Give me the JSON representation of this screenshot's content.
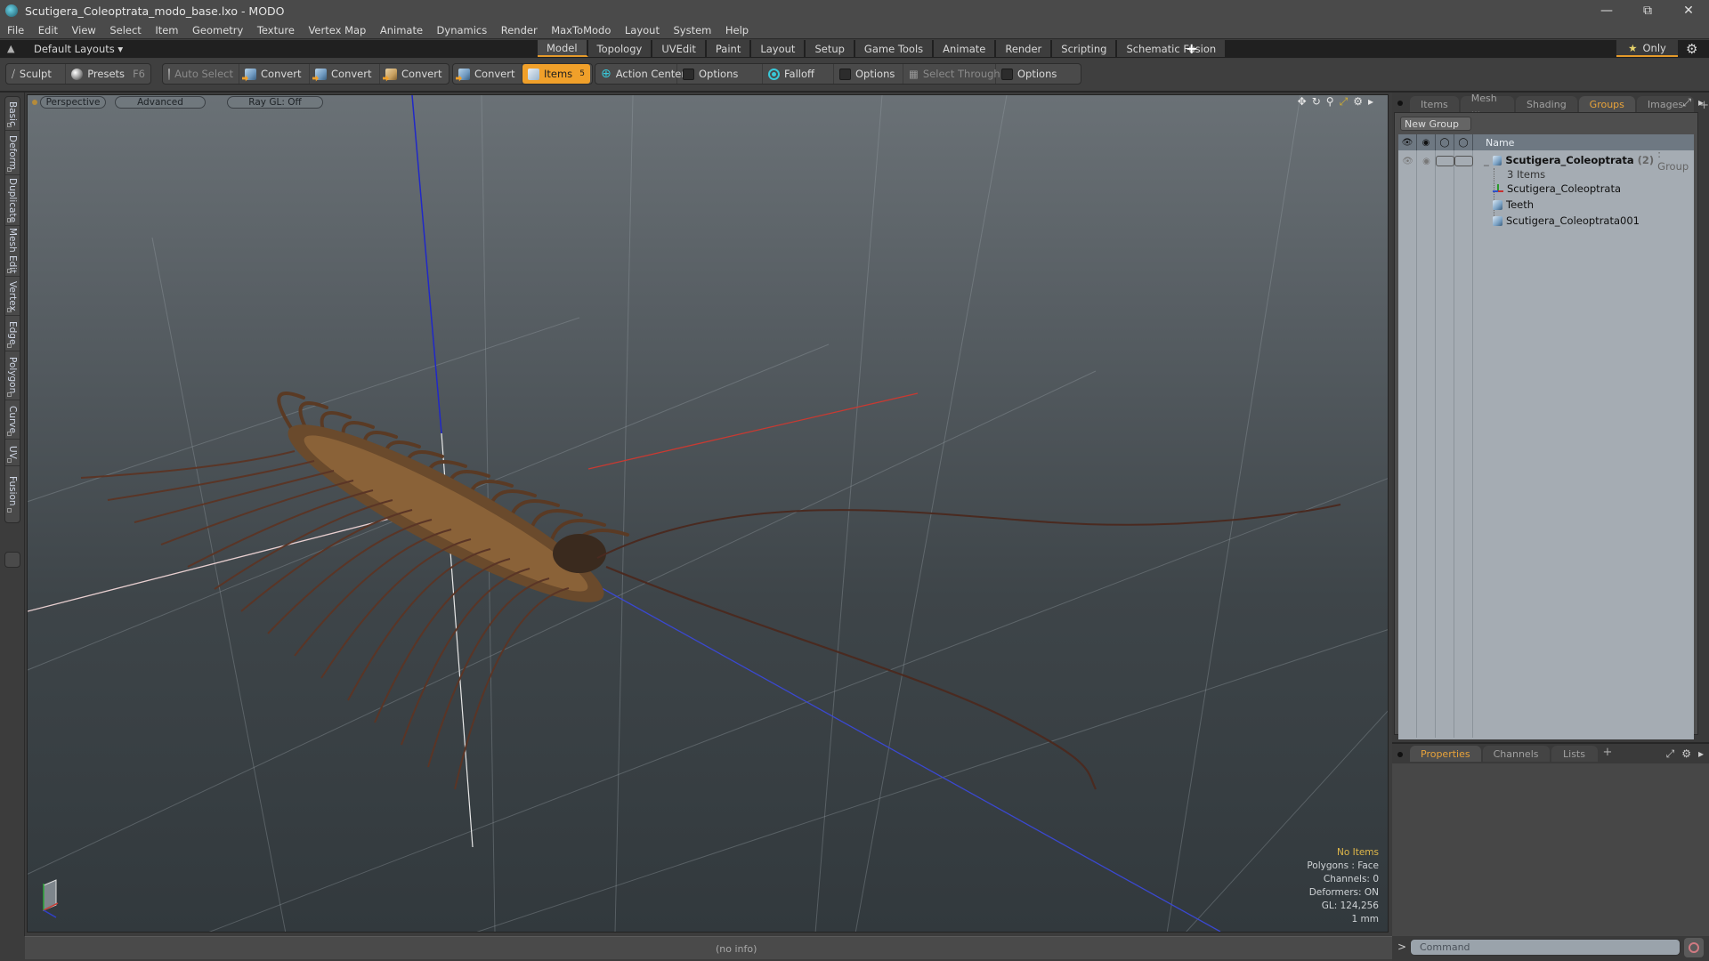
{
  "window": {
    "title": "Scutigera_Coleoptrata_modo_base.lxo - MODO",
    "controls": [
      "minimize",
      "restore",
      "close"
    ]
  },
  "menubar": {
    "items": [
      "File",
      "Edit",
      "View",
      "Select",
      "Item",
      "Geometry",
      "Texture",
      "Vertex Map",
      "Animate",
      "Dynamics",
      "Render",
      "MaxToModo",
      "Layout",
      "System",
      "Help"
    ]
  },
  "layoutbar": {
    "layouts_label": "Default Layouts",
    "tabs": [
      {
        "label": "Model",
        "active": true
      },
      {
        "label": "Topology",
        "active": false
      },
      {
        "label": "UVEdit",
        "active": false
      },
      {
        "label": "Paint",
        "active": false
      },
      {
        "label": "Layout",
        "active": false
      },
      {
        "label": "Setup",
        "active": false
      },
      {
        "label": "Game Tools",
        "active": false
      },
      {
        "label": "Animate",
        "active": false
      },
      {
        "label": "Render",
        "active": false
      },
      {
        "label": "Scripting",
        "active": false
      },
      {
        "label": "Schematic Fusion",
        "active": false
      }
    ],
    "add_tab": "+",
    "only_label": "Only"
  },
  "toolbar": {
    "sculpt": "Sculpt",
    "presets": "Presets",
    "presets_key": "F6",
    "auto_select": "Auto Select",
    "convert_1": "Convert",
    "convert_2": "Convert",
    "convert_3": "Convert",
    "convert_4": "Convert",
    "items": "Items",
    "items_count": "5",
    "action_center": "Action Center",
    "options_1": "Options",
    "falloff": "Falloff",
    "options_2": "Options",
    "select_through": "Select Through",
    "options_3": "Options"
  },
  "left_tabs": [
    "Basic",
    "Deform",
    "Duplicate",
    "Mesh Edit",
    "Vertex",
    "Edge",
    "Polygon",
    "Curve",
    "UV",
    "Fusion"
  ],
  "viewport": {
    "view_mode": "Perspective",
    "shading": "Advanced",
    "raygl": "Ray GL: Off",
    "info": {
      "selection": "No Items",
      "polygons": "Polygons : Face",
      "channels": "Channels: 0",
      "deformers": "Deformers: ON",
      "gl": "GL: 124,256",
      "unit": "1 mm"
    },
    "axis_colors": {
      "x": "#c83a32",
      "y": "#2fa83a",
      "z": "#3040c8"
    }
  },
  "right_panel": {
    "tabs": [
      {
        "label": "Items",
        "active": false
      },
      {
        "label": "Mesh ...",
        "active": false
      },
      {
        "label": "Shading",
        "active": false
      },
      {
        "label": "Groups",
        "active": true
      },
      {
        "label": "Images",
        "active": false
      }
    ],
    "new_group": "New Group",
    "column_name": "Name",
    "group": {
      "name": "Scutigera_Coleoptrata",
      "count": "(2)",
      "type": ": Group",
      "items_label": "3 Items",
      "children": [
        {
          "name": "Scutigera_Coleoptrata",
          "icon": "locator-icon"
        },
        {
          "name": "Teeth",
          "icon": "mesh-icon"
        },
        {
          "name": "Scutigera_Coleoptrata001",
          "icon": "mesh-icon"
        }
      ]
    }
  },
  "properties_panel": {
    "tabs": [
      {
        "label": "Properties",
        "active": true
      },
      {
        "label": "Channels",
        "active": false
      },
      {
        "label": "Lists",
        "active": false
      }
    ]
  },
  "statusbar": {
    "info": "(no info)"
  },
  "command": {
    "prompt": ">",
    "placeholder": "Command"
  },
  "colors": {
    "accent": "#f0a02a",
    "active_tab_text": "#e8a33a"
  }
}
